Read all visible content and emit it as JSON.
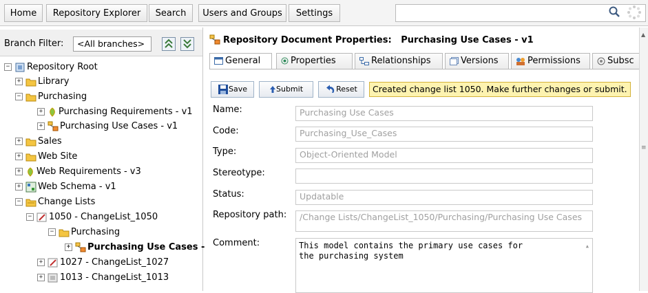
{
  "nav": {
    "tabs": [
      "Home",
      "Repository Explorer",
      "Search",
      "Users and Groups",
      "Settings"
    ],
    "search_value": ""
  },
  "left": {
    "branch_filter_label": "Branch Filter:",
    "branch_filter_value": "<All branches>",
    "tree": [
      {
        "label": "Repository Root",
        "exp": "−",
        "icon": "repository-icon"
      },
      {
        "label": "Library",
        "exp": "+",
        "icon": "folder-icon"
      },
      {
        "label": "Purchasing",
        "exp": "−",
        "icon": "folder-icon"
      },
      {
        "label": "Purchasing Requirements - v1",
        "exp": "+",
        "icon": "requirements-icon"
      },
      {
        "label": "Purchasing Use Cases - v1",
        "exp": "+",
        "icon": "model-icon"
      },
      {
        "label": "Sales",
        "exp": "+",
        "icon": "folder-icon"
      },
      {
        "label": "Web Site",
        "exp": "+",
        "icon": "folder-icon"
      },
      {
        "label": "Web Requirements - v3",
        "exp": "+",
        "icon": "requirements-icon"
      },
      {
        "label": "Web Schema - v1",
        "exp": "+",
        "icon": "schema-icon"
      },
      {
        "label": "Change Lists",
        "exp": "−",
        "icon": "changelists-folder-icon"
      },
      {
        "label": "1050 - ChangeList_1050",
        "exp": "−",
        "icon": "changelist-edit-icon"
      },
      {
        "label": "Purchasing",
        "exp": "−",
        "icon": "folder-icon"
      },
      {
        "label": "Purchasing Use Cases -",
        "exp": "+",
        "icon": "model-icon"
      },
      {
        "label": "1027 - ChangeList_1027",
        "exp": "+",
        "icon": "changelist-edit-icon"
      },
      {
        "label": "1013 - ChangeList_1013",
        "exp": "+",
        "icon": "changelist-icon"
      }
    ]
  },
  "doc": {
    "title": "Repository Document Properties:   Purchasing Use Cases - v1",
    "tabs": [
      "General",
      "Properties",
      "Relationships",
      "Versions",
      "Permissions",
      "Subsc"
    ],
    "buttons": {
      "save": "Save",
      "submit": "Submit",
      "reset": "Reset"
    },
    "message": "Created change list 1050. Make further changes or submit.",
    "fields": {
      "name_label": "Name:",
      "name_value": "Purchasing Use Cases",
      "code_label": "Code:",
      "code_value": "Purchasing_Use_Cases",
      "type_label": "Type:",
      "type_value": "Object-Oriented Model",
      "stereotype_label": "Stereotype:",
      "stereotype_value": "",
      "status_label": "Status:",
      "status_value": "Updatable",
      "path_label": "Repository path:",
      "path_value": "/Change Lists/ChangeList_1050/Purchasing/Purchasing Use Cases",
      "comment_label": "Comment:",
      "comment_value": "This model contains the primary use cases for\nthe purchasing system"
    }
  },
  "colors": {
    "folder": "#f4c542",
    "message_bg": "#fdf3b0",
    "accent_blue": "#2a5db0"
  }
}
